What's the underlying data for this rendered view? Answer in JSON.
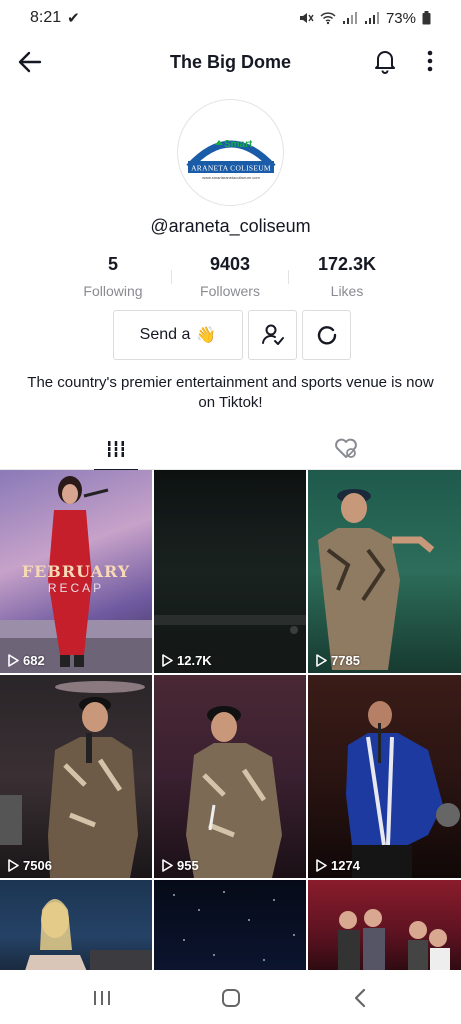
{
  "status_bar": {
    "time": "8:21",
    "battery": "73%"
  },
  "header": {
    "title": "The Big Dome"
  },
  "profile": {
    "avatar_logo": {
      "brand": "Smart",
      "name": "ARANETA COLISEUM",
      "url": "www.smartaranetacoliseum.com"
    },
    "username": "@araneta_coliseum",
    "stats": [
      {
        "value": "5",
        "label": "Following"
      },
      {
        "value": "9403",
        "label": "Followers"
      },
      {
        "value": "172.3K",
        "label": "Likes"
      }
    ],
    "send_button": "Send a",
    "send_emoji": "👋",
    "bio": "The country's premier entertainment and sports venue is now on Tiktok!"
  },
  "tabs": {
    "videos_icon": "grid-icon",
    "liked_icon": "hidden-heart-icon"
  },
  "videos": [
    {
      "views": "682",
      "overlay_title": "FEBRUARY",
      "overlay_subtitle": "RECAP"
    },
    {
      "views": "12.7K"
    },
    {
      "views": "7785"
    },
    {
      "views": "7506"
    },
    {
      "views": "955"
    },
    {
      "views": "1274"
    },
    {
      "views": ""
    },
    {
      "views": ""
    },
    {
      "views": ""
    }
  ],
  "colors": {
    "text_primary": "#161823",
    "text_secondary": "#8a8b91",
    "border": "#dcdcdd",
    "smart_green": "#18a84a",
    "araneta_blue": "#1a5ca8"
  }
}
